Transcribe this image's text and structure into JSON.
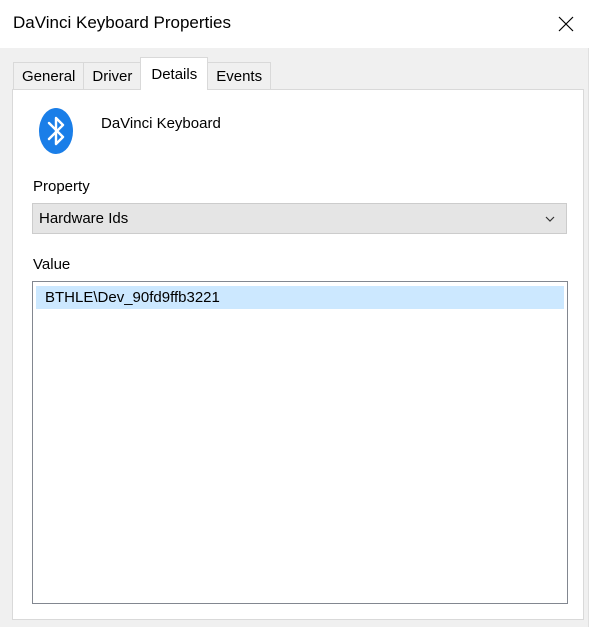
{
  "window": {
    "title": "DaVinci Keyboard Properties"
  },
  "tabs": [
    {
      "label": "General",
      "active": false
    },
    {
      "label": "Driver",
      "active": false
    },
    {
      "label": "Details",
      "active": true
    },
    {
      "label": "Events",
      "active": false
    }
  ],
  "device": {
    "icon": "bluetooth-icon",
    "name": "DaVinci Keyboard"
  },
  "property": {
    "label": "Property",
    "selected": "Hardware Ids"
  },
  "value": {
    "label": "Value",
    "items": [
      "BTHLE\\Dev_90fd9ffb3221"
    ]
  },
  "colors": {
    "bluetooth": "#1a7ee8",
    "selection": "#cce8ff"
  }
}
